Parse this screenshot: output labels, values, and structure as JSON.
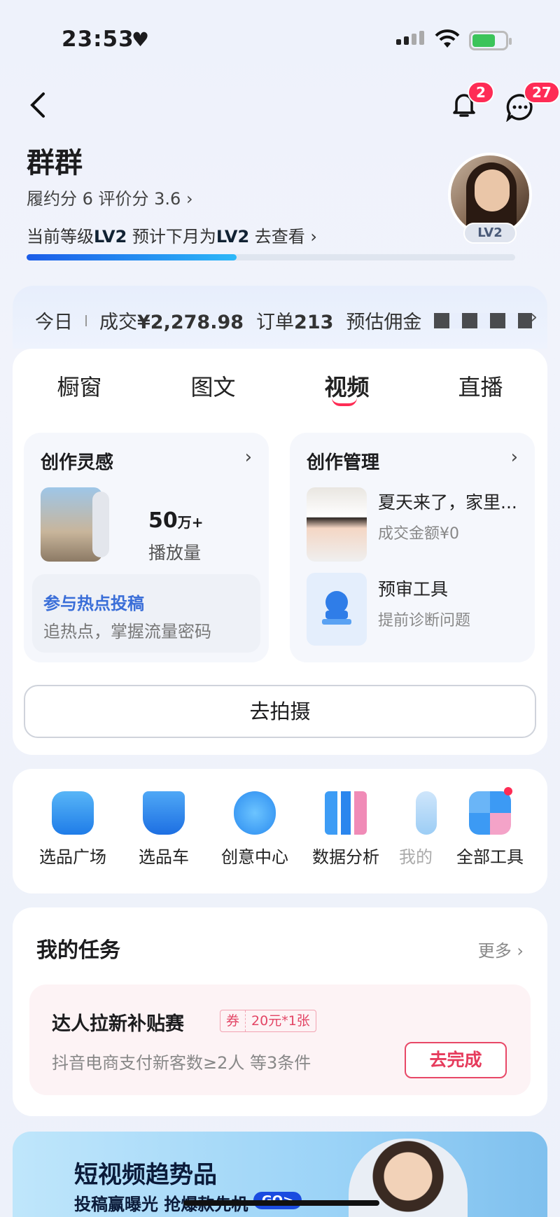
{
  "status_bar": {
    "time": "23:53",
    "heart": "♥"
  },
  "header": {
    "back_icon": "chevron-left-icon",
    "notification_count": "2",
    "message_count": "27"
  },
  "profile": {
    "name": "群群",
    "scores": "履约分 6  评价分 3.6  ›",
    "level_prefix": "当前等级",
    "level_current": "LV2",
    "level_mid": " 预计下月为",
    "level_next": "LV2",
    "level_link": " 去查看 ›",
    "avatar_badge": "LV2",
    "progress": 0.43
  },
  "stats": {
    "today": "今日",
    "deal_label": "成交",
    "deal_value": "¥2,278.98",
    "order_label": "订单",
    "order_value": "213",
    "commission_label": "预估佣金"
  },
  "tabs": [
    "橱窗",
    "图文",
    "视频",
    "直播"
  ],
  "active_tab": "视频",
  "inspiration": {
    "title": "创作灵感",
    "plays_value": "50",
    "plays_unit": "万+",
    "plays_label": "播放量",
    "hot_title": "参与热点投稿",
    "hot_desc": "追热点，掌握流量密码"
  },
  "management": {
    "title": "创作管理",
    "video_title": "夏天来了，家里...",
    "video_sales": "成交金额¥0",
    "review_title": "预审工具",
    "review_desc": "提前诊断问题"
  },
  "shoot_button": "去拍摄",
  "tools": [
    {
      "label": "选品广场",
      "icon": "shopping-bag-icon"
    },
    {
      "label": "选品车",
      "icon": "cart-icon"
    },
    {
      "label": "创意中心",
      "icon": "lightbulb-icon"
    },
    {
      "label": "数据分析",
      "icon": "bar-chart-icon"
    },
    {
      "label": "我的",
      "icon": "document-icon"
    },
    {
      "label": "全部工具",
      "icon": "grid-icon"
    }
  ],
  "tasks": {
    "title": "我的任务",
    "more": "更多 ›",
    "item": {
      "title": "达人拉新补贴赛",
      "coupon_tag": "券",
      "coupon_value": "20元*1张",
      "desc": "抖音电商支付新客数≥2人  等3条件",
      "action": "去完成"
    }
  },
  "banner": {
    "headline": "短视频趋势品",
    "subline": "投稿赢曝光 抢爆款先机",
    "go": "GO>"
  }
}
